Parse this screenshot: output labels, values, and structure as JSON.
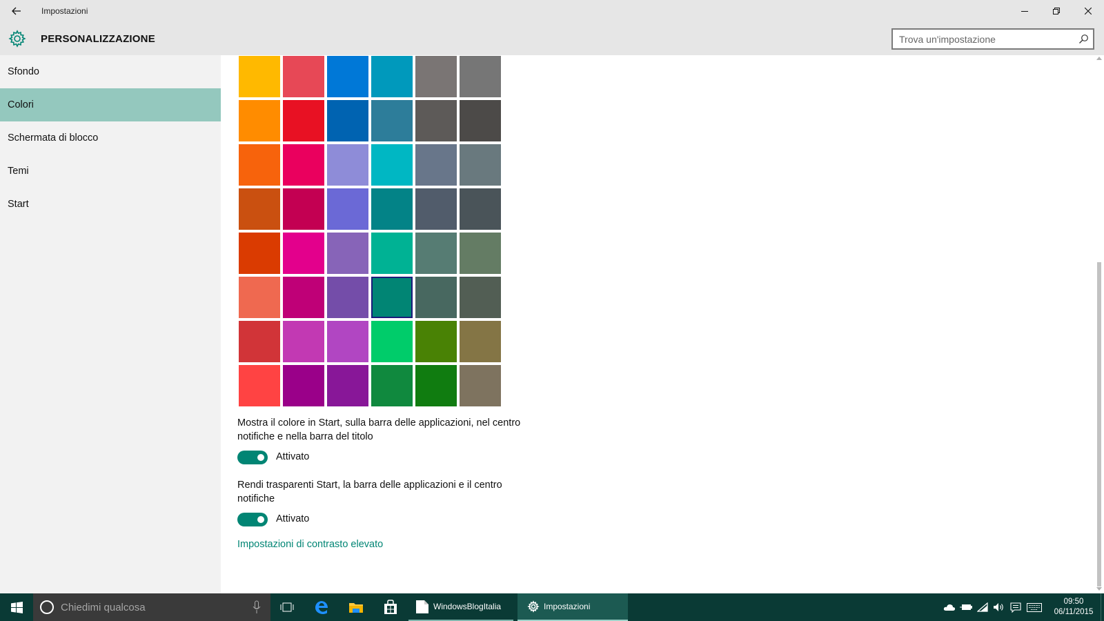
{
  "window": {
    "title": "Impostazioni"
  },
  "header": {
    "title": "PERSONALIZZAZIONE",
    "search_placeholder": "Trova un'impostazione"
  },
  "sidebar": {
    "items": [
      {
        "label": "Sfondo",
        "selected": false
      },
      {
        "label": "Colori",
        "selected": true
      },
      {
        "label": "Schermata di blocco",
        "selected": false
      },
      {
        "label": "Temi",
        "selected": false
      },
      {
        "label": "Start",
        "selected": false
      }
    ]
  },
  "colors": {
    "accent": "#018574",
    "sidebar_selected": "#94c8be",
    "selected_swatch": [
      5,
      3
    ],
    "swatches": [
      [
        "#FFB900",
        "#E74856",
        "#0078D7",
        "#0099BC",
        "#7A7574",
        "#767676"
      ],
      [
        "#FF8C00",
        "#E81123",
        "#0063B1",
        "#2D7D9A",
        "#5D5A58",
        "#4C4A48"
      ],
      [
        "#F7630C",
        "#EA005E",
        "#8E8CD8",
        "#00B7C3",
        "#68768A",
        "#69797E"
      ],
      [
        "#CA5010",
        "#C30052",
        "#6B69D6",
        "#038387",
        "#515C6B",
        "#4A5459"
      ],
      [
        "#DA3B01",
        "#E3008C",
        "#8764B8",
        "#00B294",
        "#567C73",
        "#647C64"
      ],
      [
        "#EF6950",
        "#BF0077",
        "#744DA9",
        "#018574",
        "#486860",
        "#525E54"
      ],
      [
        "#D13438",
        "#C239B3",
        "#B146C2",
        "#00CC6A",
        "#498205",
        "#847545"
      ],
      [
        "#FF4343",
        "#9A0089",
        "#881798",
        "#10893E",
        "#107C10",
        "#7E735F"
      ]
    ]
  },
  "settings": {
    "show_color": {
      "label": "Mostra il colore in Start, sulla barra delle applicazioni, nel centro notifiche e nella barra del titolo",
      "state": "Attivato"
    },
    "transparency": {
      "label": "Rendi trasparenti Start, la barra delle applicazioni e il centro notifiche",
      "state": "Attivato"
    },
    "contrast_link": "Impostazioni di contrasto elevato"
  },
  "taskbar": {
    "search_placeholder": "Chiedimi qualcosa",
    "apps": [
      {
        "label": "WindowsBlogItalia",
        "icon": "document-window-icon"
      },
      {
        "label": "Impostazioni",
        "icon": "gear-icon"
      }
    ],
    "clock": {
      "time": "09:50",
      "date": "06/11/2015"
    }
  }
}
